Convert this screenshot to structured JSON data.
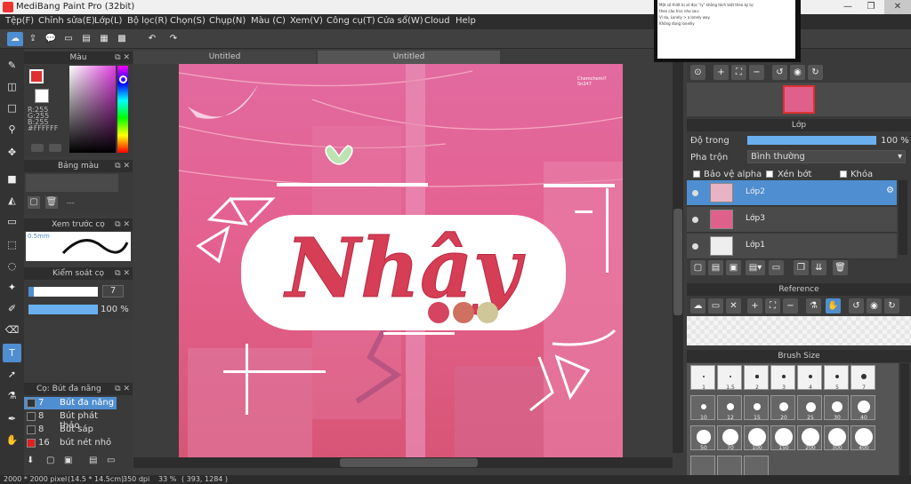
{
  "title": "MediBang Paint Pro (32bit)",
  "menu": [
    "Tệp(F)",
    "Chỉnh sửa(E)",
    "Lớp(L)",
    "Bộ lọc(R)",
    "Chọn(S)",
    "Chụp(N)",
    "Màu (C)",
    "Xem(V)",
    "Công cụ(T)",
    "Cửa sổ(W)",
    "Cloud",
    "Help"
  ],
  "color_panel": {
    "title": "Màu",
    "r": "R:255",
    "g": "G:255",
    "b": "B:255",
    "hex": "#FFFFFF",
    "primary": "#e03030",
    "secondary": "#ffffff"
  },
  "palette_panel": {
    "title": "Bảng màu",
    "dash": "---"
  },
  "preview_panel": {
    "title": "Xem trước cọ",
    "size": "0.5mm"
  },
  "control_panel": {
    "title": "Kiểm soát cọ",
    "size": "7",
    "opacity": "100 %"
  },
  "brush_panel": {
    "title": "Cọ: Bút đa năng",
    "items": [
      {
        "size": "7",
        "name": "Bút đa năng",
        "color": "#333333"
      },
      {
        "size": "8",
        "name": "Bút phát thảo",
        "color": "#333333"
      },
      {
        "size": "8",
        "name": "Bút sáp",
        "color": "#333333"
      },
      {
        "size": "16",
        "name": "bút nét nhỏ",
        "color": "#e02020"
      }
    ]
  },
  "tabs": [
    "Untitled",
    "Untitled"
  ],
  "artwork": {
    "text": "Nhây",
    "signature": "Chemchemi? Sn247"
  },
  "popup": {
    "lines": [
      "Một số thiết bị sẽ đọc \"ly\" không tách biệt theo ký tự",
      "theo câu trúc như sau: ",
      "Ví dụ, Lonely > a lonely way.",
      "Không dùng lonelily"
    ]
  },
  "layer_panel": {
    "title": "Lớp",
    "opacity_label": "Độ trong",
    "opacity": "100 %",
    "opacity_value": 1.0,
    "blend_label": "Pha trộn",
    "blend": "Bình thường",
    "protect_alpha": "Bảo vệ alpha",
    "clipping": "Xén bớt",
    "lock": "Khóa",
    "layers": [
      {
        "name": "Lớp2",
        "selected": true
      },
      {
        "name": "Lớp3",
        "selected": false
      },
      {
        "name": "Lớp1",
        "selected": false
      }
    ]
  },
  "reference_panel": {
    "title": "Reference"
  },
  "brush_size_panel": {
    "title": "Brush Size",
    "sizes": [
      "1",
      "1.5",
      "2",
      "3",
      "4",
      "5",
      "7",
      "10",
      "12",
      "15",
      "20",
      "25",
      "30",
      "40",
      "50",
      "70",
      "100",
      "150",
      "200",
      "300",
      "400",
      "",
      "",
      ""
    ]
  },
  "status": {
    "pixels": "2000 * 2000 pixel",
    "cm": "(14.5 * 14.5cm)",
    "dpi": "350 dpi",
    "zoom": "33 %",
    "coords": "( 393, 1284 )"
  }
}
